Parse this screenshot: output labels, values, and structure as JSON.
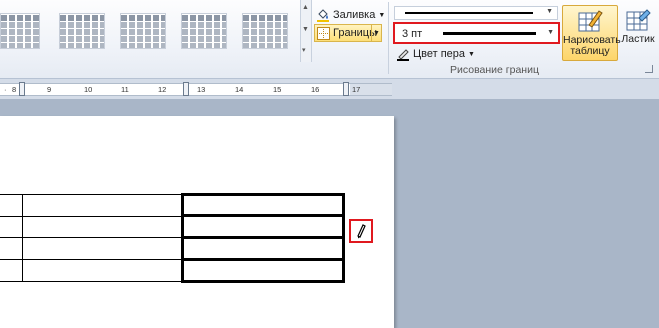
{
  "ribbon": {
    "gallery": {
      "thumb_count": 5
    },
    "shading": {
      "label": "Заливка"
    },
    "borders": {
      "label": "Границы"
    },
    "draw_borders": {
      "pen_weight": "3 пт",
      "pen_color_label": "Цвет пера",
      "group_label": "Рисование границ",
      "draw_table_label_line1": "Нарисовать",
      "draw_table_label_line2": "таблицу",
      "eraser_label": "Ластик"
    }
  },
  "ruler": {
    "ticks": [
      "8",
      "9",
      "10",
      "11",
      "12",
      "13",
      "14",
      "15",
      "16",
      "17"
    ]
  },
  "colors": {
    "highlight": "#e0191f",
    "active_button": "#fdd56a"
  }
}
